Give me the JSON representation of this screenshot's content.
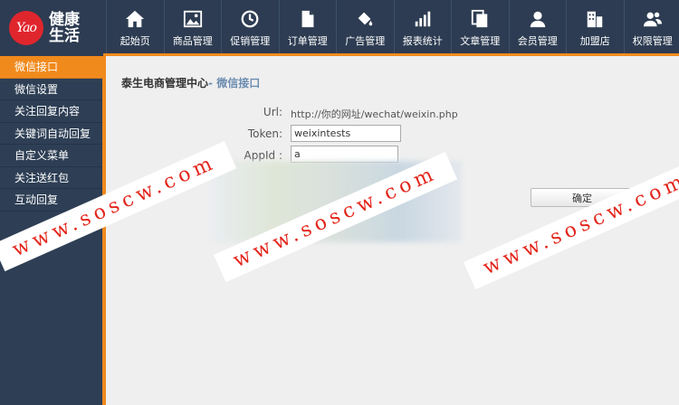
{
  "logo": {
    "badge": "Yao",
    "text": "健康生活"
  },
  "nav": [
    {
      "label": "起始页",
      "icon": "home-icon"
    },
    {
      "label": "商品管理",
      "icon": "image-icon"
    },
    {
      "label": "促销管理",
      "icon": "clock-icon"
    },
    {
      "label": "订单管理",
      "icon": "document-icon"
    },
    {
      "label": "广告管理",
      "icon": "paint-bucket-icon"
    },
    {
      "label": "报表统计",
      "icon": "bar-chart-icon"
    },
    {
      "label": "文章管理",
      "icon": "copy-icon"
    },
    {
      "label": "会员管理",
      "icon": "user-icon"
    },
    {
      "label": "加盟店",
      "icon": "building-icon"
    },
    {
      "label": "权限管理",
      "icon": "users-icon"
    }
  ],
  "sidebar": {
    "items": [
      {
        "label": "微信接口",
        "active": true
      },
      {
        "label": "微信设置"
      },
      {
        "label": "关注回复内容"
      },
      {
        "label": "关键词自动回复"
      },
      {
        "label": "自定义菜单"
      },
      {
        "label": "关注送红包"
      },
      {
        "label": "互动回复"
      }
    ]
  },
  "breadcrumb": {
    "main": "泰生电商管理中心",
    "sep": "- ",
    "sub": "微信接口"
  },
  "form": {
    "url_label": "Url:",
    "url_value": "http://你的网址/wechat/weixin.php",
    "token_label": "Token:",
    "token_value": "weixintests",
    "appid_label": "AppId :",
    "appid_value": "a",
    "submit_label": "确定"
  },
  "watermarks": [
    "www.soscw.com",
    "www.soscw.com",
    "www.soscw.com"
  ],
  "colors": {
    "accent": "#f08a1d",
    "nav_bg": "#2d3c52",
    "sidebar_bg": "#2e3f55",
    "watermark": "#e3261c"
  }
}
